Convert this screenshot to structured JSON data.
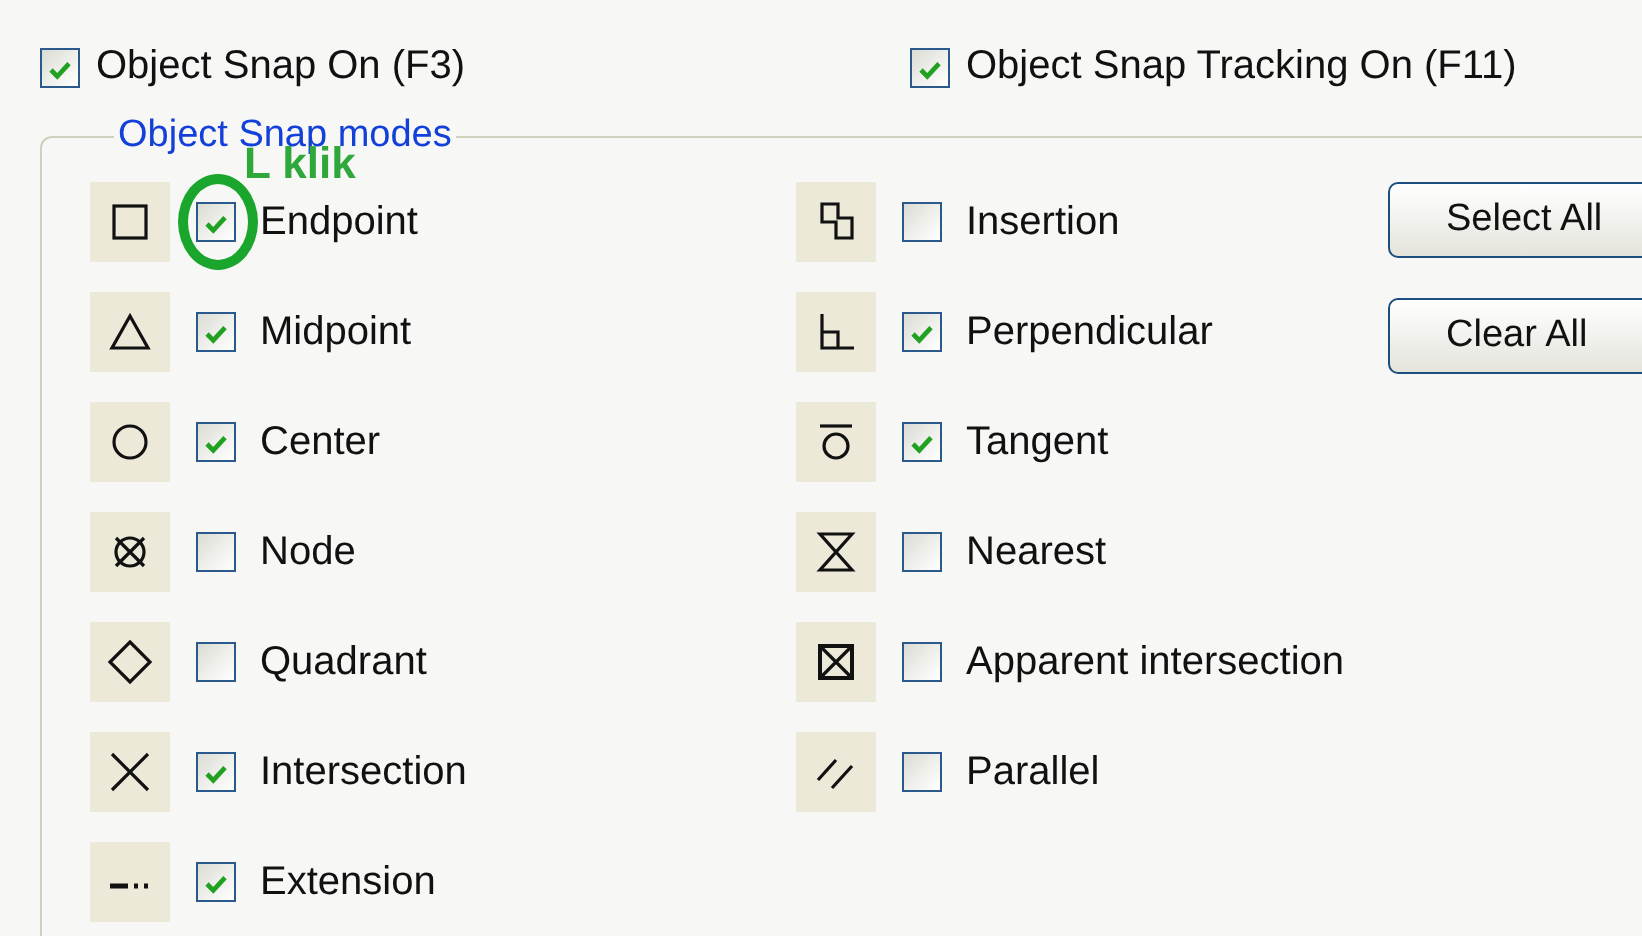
{
  "top_options": [
    {
      "label": "Object Snap On (F3)",
      "checked": true
    },
    {
      "label": "Object Snap Tracking On (F11)",
      "checked": true
    }
  ],
  "group": {
    "title": "Object Snap modes"
  },
  "left_items": [
    {
      "kind": "endpoint",
      "label": "Endpoint",
      "checked": true,
      "annotation": "L klik"
    },
    {
      "kind": "midpoint",
      "label": "Midpoint",
      "checked": true
    },
    {
      "kind": "center",
      "label": "Center",
      "checked": true
    },
    {
      "kind": "node",
      "label": "Node",
      "checked": false
    },
    {
      "kind": "quadrant",
      "label": "Quadrant",
      "checked": false
    },
    {
      "kind": "intersection",
      "label": "Intersection",
      "checked": true
    },
    {
      "kind": "extension",
      "label": "Extension",
      "checked": true
    }
  ],
  "right_items": [
    {
      "kind": "insertion",
      "label": "Insertion",
      "checked": false
    },
    {
      "kind": "perpendicular",
      "label": "Perpendicular",
      "checked": true
    },
    {
      "kind": "tangent",
      "label": "Tangent",
      "checked": true
    },
    {
      "kind": "nearest",
      "label": "Nearest",
      "checked": false
    },
    {
      "kind": "apparent",
      "label": "Apparent intersection",
      "checked": false
    },
    {
      "kind": "parallel",
      "label": "Parallel",
      "checked": false
    }
  ],
  "buttons": [
    "Select All",
    "Clear All"
  ]
}
